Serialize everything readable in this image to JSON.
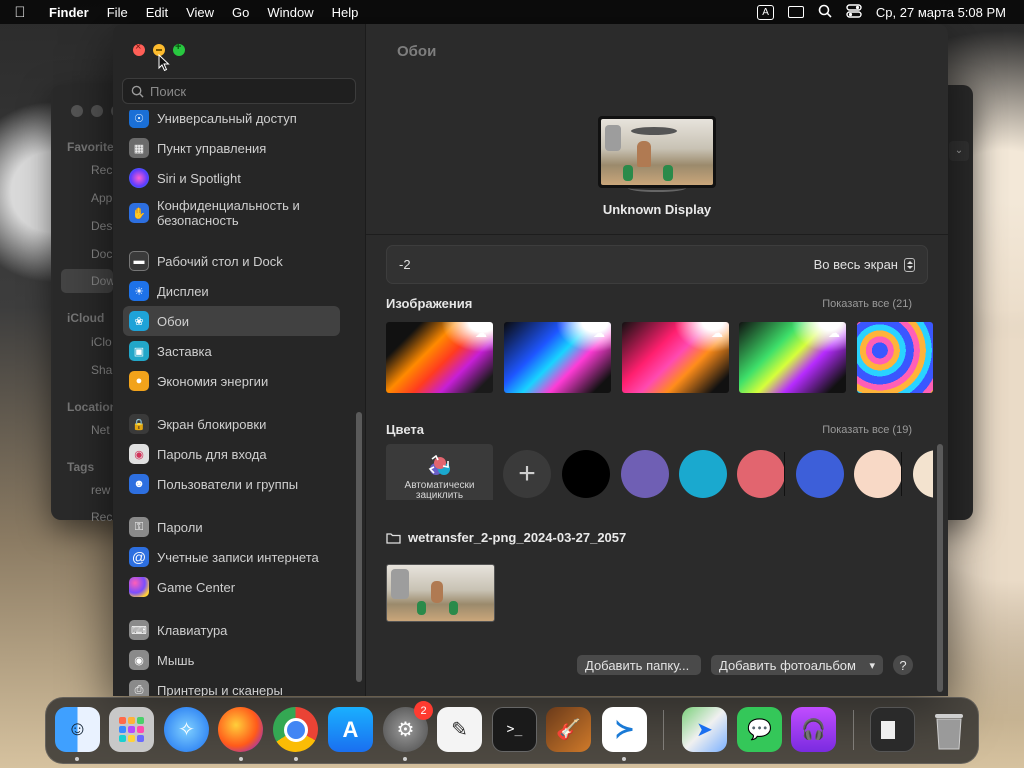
{
  "menubar": {
    "app": "Finder",
    "items": [
      "File",
      "Edit",
      "View",
      "Go",
      "Window",
      "Help"
    ],
    "input_source": "A",
    "datetime": "Ср, 27 марта  5:08 PM"
  },
  "finder_bg": {
    "sections": [
      "Favorite",
      "iCloud",
      "Location",
      "Tags"
    ],
    "items": [
      "Rec",
      "App",
      "Des",
      "Doc",
      "Dow",
      "iClo",
      "Sha",
      "Net",
      "rew",
      "Rec"
    ]
  },
  "settings": {
    "search_placeholder": "Поиск",
    "sidebar": [
      {
        "label": "Универсальный доступ",
        "icon": "accessibility-icon",
        "color": "#1a6fd6"
      },
      {
        "label": "Пункт управления",
        "icon": "control-center-icon",
        "color": "#6b6b6b"
      },
      {
        "label": "Siri и Spotlight",
        "icon": "siri-icon",
        "color": "#9b44d6"
      },
      {
        "label": "Конфиденциальность и безопасность",
        "icon": "privacy-hand-icon",
        "color": "#2d6fe0"
      },
      {
        "label": "Рабочий стол и Dock",
        "icon": "desktop-dock-icon",
        "color": "#3a3a3a"
      },
      {
        "label": "Дисплеи",
        "icon": "displays-icon",
        "color": "#1e72e8"
      },
      {
        "label": "Обои",
        "icon": "wallpaper-icon",
        "color": "#1ea3d8"
      },
      {
        "label": "Заставка",
        "icon": "screensaver-icon",
        "color": "#22a7c9"
      },
      {
        "label": "Экономия энергии",
        "icon": "energy-icon",
        "color": "#f2a31b"
      },
      {
        "label": "Экран блокировки",
        "icon": "lock-screen-icon",
        "color": "#3a3a3a"
      },
      {
        "label": "Пароль для входа",
        "icon": "touch-id-icon",
        "color": "#e0e0e0"
      },
      {
        "label": "Пользователи и группы",
        "icon": "users-icon",
        "color": "#2d6fe0"
      },
      {
        "label": "Пароли",
        "icon": "key-icon",
        "color": "#8a8a8a"
      },
      {
        "label": "Учетные записи интернета",
        "icon": "at-icon",
        "color": "#2d6fe0"
      },
      {
        "label": "Game Center",
        "icon": "game-center-icon",
        "color": "#c04de0"
      },
      {
        "label": "Клавиатура",
        "icon": "keyboard-icon",
        "color": "#8a8a8a"
      },
      {
        "label": "Мышь",
        "icon": "mouse-icon",
        "color": "#8a8a8a"
      },
      {
        "label": "Принтеры и сканеры",
        "icon": "printer-icon",
        "color": "#8a8a8a"
      }
    ],
    "selected_index": 6,
    "main": {
      "title": "Обои",
      "display_name": "Unknown Display",
      "wallpaper_value": "-2",
      "fit_mode": "Во весь экран",
      "images_label": "Изображения",
      "images_show_all": "Показать все (21)",
      "colors_label": "Цвета",
      "colors_show_all": "Показать все (19)",
      "auto_cycle_label": "Автоматически зациклить",
      "color_swatches": [
        "#000000",
        "#6f5fb4",
        "#1aa9cf",
        "#e2656f",
        "#3d5fd9",
        "#f8d9c6",
        "#f3e3cf"
      ],
      "folder_name": "wetransfer_2-png_2024-03-27_2057",
      "add_folder_button": "Добавить папку...",
      "add_album_button": "Добавить фотоальбом",
      "help_button": "?"
    }
  },
  "dock": {
    "apps": [
      "Finder",
      "Launchpad",
      "Safari",
      "Firefox",
      "Chrome",
      "App Store",
      "System Settings",
      "TextEdit",
      "Terminal",
      "GarageBand",
      "VS Code",
      "Maps",
      "Messages",
      "Podcasts",
      "Downloads",
      "Trash"
    ],
    "settings_badge": "2"
  }
}
